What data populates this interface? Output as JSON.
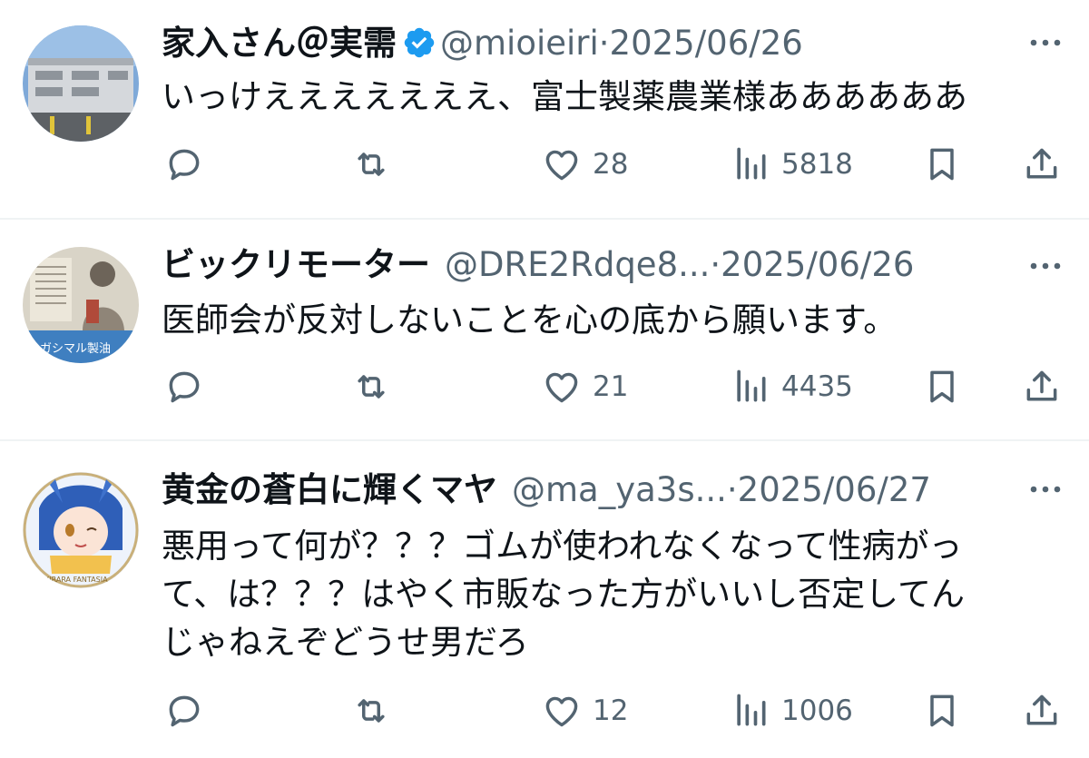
{
  "tweets": [
    {
      "name": "家入さん＠実需",
      "verified": true,
      "handle": "@mioieiri",
      "separator": "·",
      "date": "2025/06/26",
      "text": [
        "いっけえええええええ、富士製薬農業様ああああああ"
      ],
      "likes": "28",
      "views": "5818"
    },
    {
      "name": "ビックリモーター",
      "verified": false,
      "handle": "@DRE2Rdqe8...",
      "separator": "·",
      "date": "2025/06/26",
      "text": [
        "医師会が反対しないことを心の底から願います。"
      ],
      "likes": "21",
      "views": "4435",
      "avatar_caption": "ーガシマル製油"
    },
    {
      "name": "黄金の蒼白に輝くマヤ",
      "verified": false,
      "handle": "@ma_ya3s...",
      "separator": "·",
      "date": "2025/06/27",
      "text": [
        "悪用って何が？？？ゴムが使われなくなって性病がっ",
        "て、は？？？はやく市販なった方がいいし否定してん",
        "じゃねえぞどうせ男だろ"
      ],
      "likes": "12",
      "views": "1006",
      "avatar_caption": "KIRARA FANTASIA"
    }
  ],
  "icons": {
    "reply": "reply-icon",
    "retweet": "retweet-icon",
    "like": "heart-icon",
    "views": "views-icon",
    "bookmark": "bookmark-icon",
    "share": "share-icon",
    "more": "more-icon",
    "verified": "verified-badge-icon"
  },
  "colors": {
    "text": "#0f1419",
    "secondary": "#536471",
    "verified": "#1d9bf0",
    "divider": "#eff3f4"
  }
}
